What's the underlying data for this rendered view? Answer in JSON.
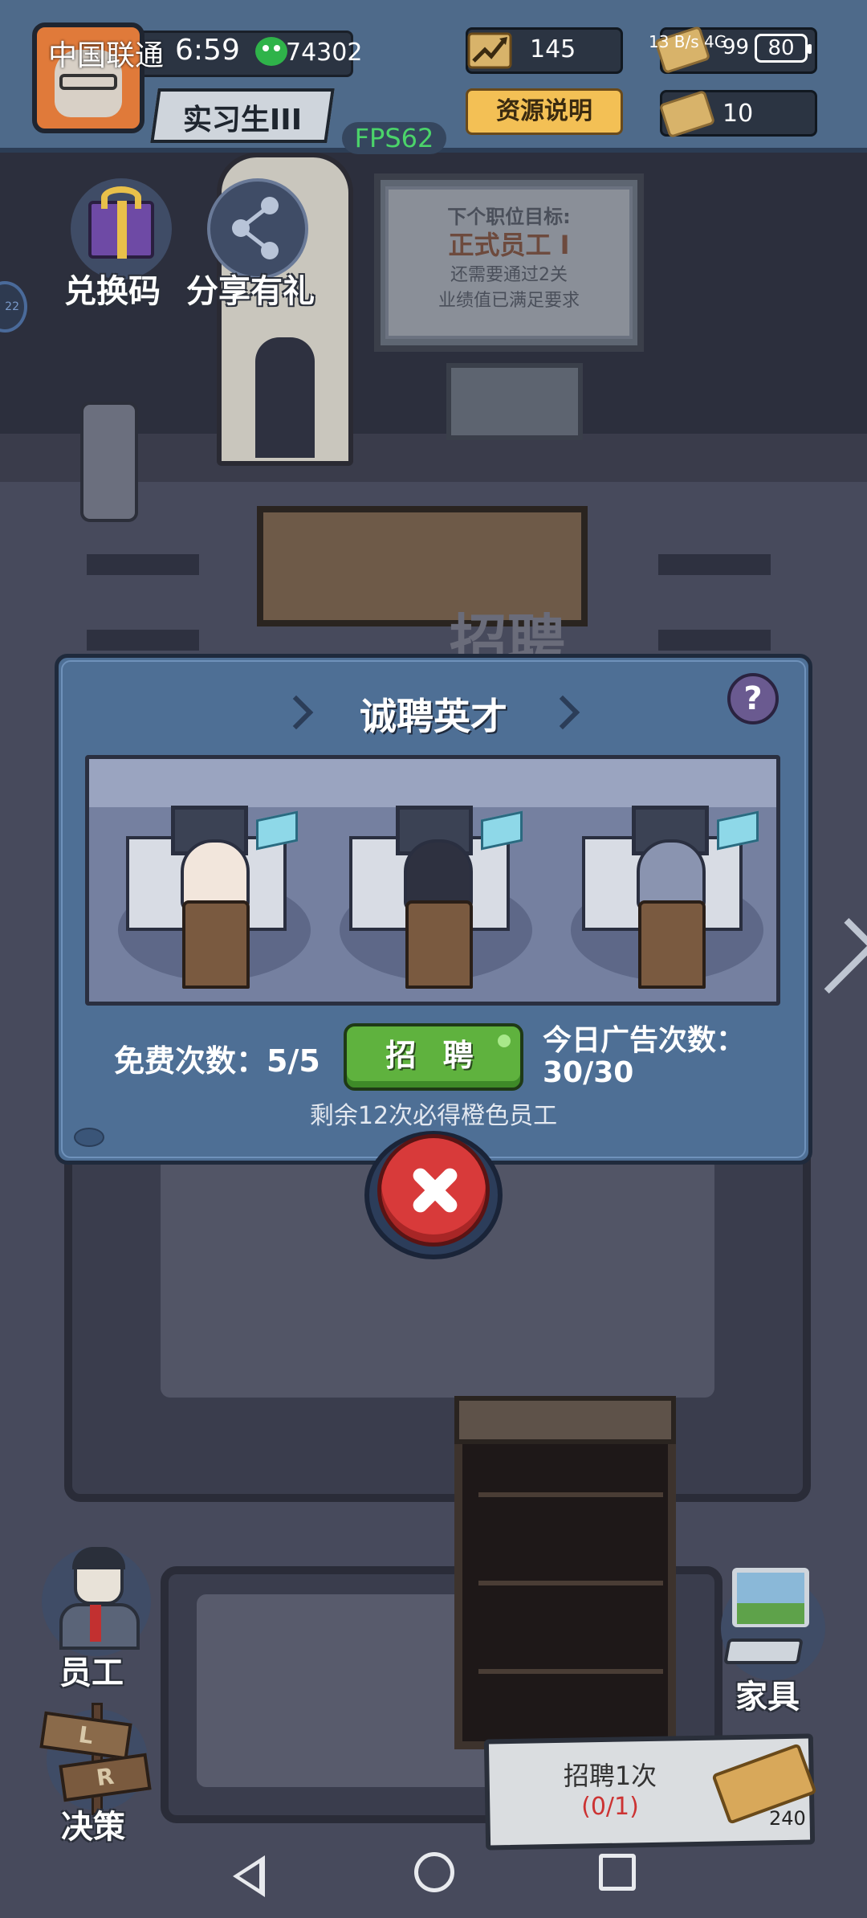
{
  "status_bar": {
    "carrier": "中国联通",
    "time": "6:59",
    "network_speed": "13 B/s",
    "network_type": "4G",
    "battery": "80"
  },
  "player": {
    "uid": "74302",
    "rank": "实习生III",
    "fps": "FPS62"
  },
  "resources": {
    "growth": "145",
    "coins": "10",
    "coins_partial": "99",
    "explain_button": "资源说明"
  },
  "side_icons": {
    "redeem_code": "兑换码",
    "share_gift": "分享有礼",
    "side_badge": "22"
  },
  "notice_board": {
    "line1": "下个职位目标:",
    "line2": "正式员工 I",
    "line3": "还需要通过2关",
    "line4": "业绩值已满足要求"
  },
  "scene_sign": "招聘",
  "dialog": {
    "title": "诚聘英才",
    "help": "?",
    "free_label": "免费次数：5/5",
    "recruit_button": "招 聘",
    "ad_label_line1": "今日广告次数：",
    "ad_label_line2": "30/30",
    "hint": "剩余12次必得橙色员工"
  },
  "bottom_actions": {
    "employees": "员工",
    "decision": "决策",
    "furniture": "家具",
    "sign_l": "L",
    "sign_r": "R",
    "recruit_once": "招聘1次",
    "recruit_progress": "(0/1)",
    "recruit_cost": "240"
  },
  "colors": {
    "dialog_bg": "#4e6f95",
    "recruit_green": "#5fb23e",
    "close_red": "#d83a3a",
    "explain_yellow": "#f3c055",
    "fps_green": "#4bd46a"
  }
}
